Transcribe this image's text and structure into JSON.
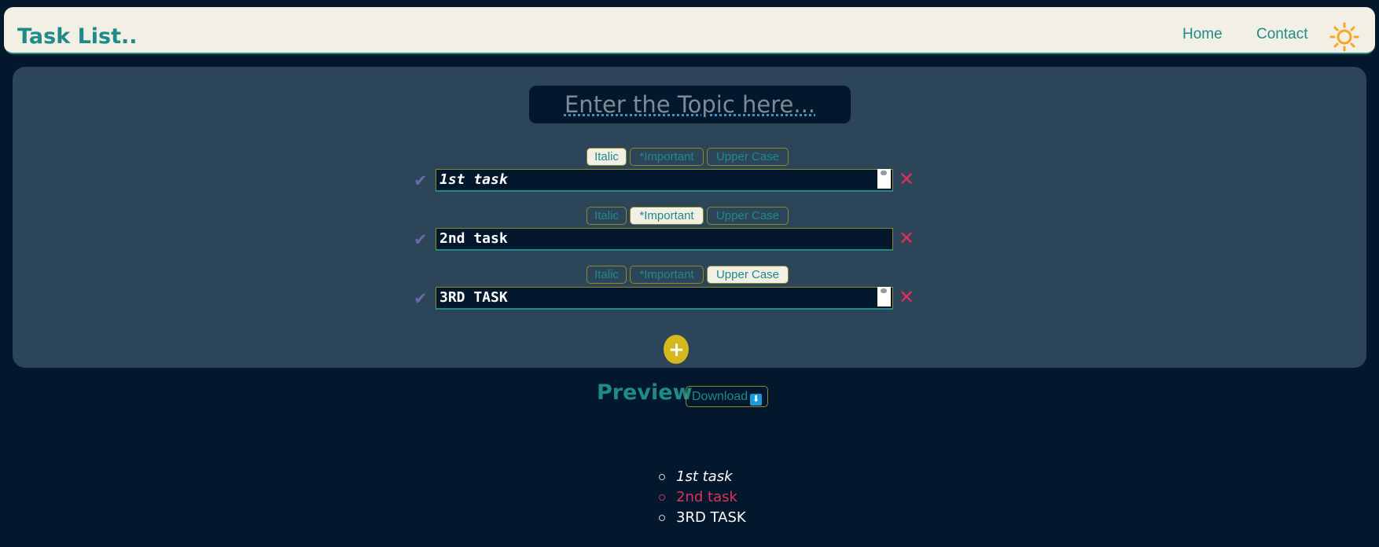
{
  "header": {
    "brand": "Task List..",
    "nav": [
      {
        "label": "Home"
      },
      {
        "label": "Contact"
      }
    ],
    "theme_icon": "sun-icon",
    "accent_color": "#1f8a8a"
  },
  "editor": {
    "topic_placeholder": "Enter the Topic here...",
    "toolbar_labels": {
      "italic": "Italic",
      "important": "*Important",
      "upper_case": "Upper Case"
    },
    "tasks": [
      {
        "text": "1st task",
        "italic": true,
        "important": false,
        "upper_case": false
      },
      {
        "text": "2nd task",
        "italic": false,
        "important": true,
        "upper_case": false
      },
      {
        "text": "3RD TASK",
        "italic": false,
        "important": false,
        "upper_case": true
      }
    ],
    "check_icon": "checkmark-icon",
    "delete_icon": "close-icon",
    "add_button": "+"
  },
  "preview": {
    "title": "Preview",
    "download_label": "Download",
    "download_icon": "⬇",
    "items": [
      {
        "text": "1st task",
        "style": "italic"
      },
      {
        "text": "2nd task",
        "style": "important"
      },
      {
        "text": "3RD TASK",
        "style": "normal"
      }
    ],
    "important_color": "#e0305a"
  }
}
